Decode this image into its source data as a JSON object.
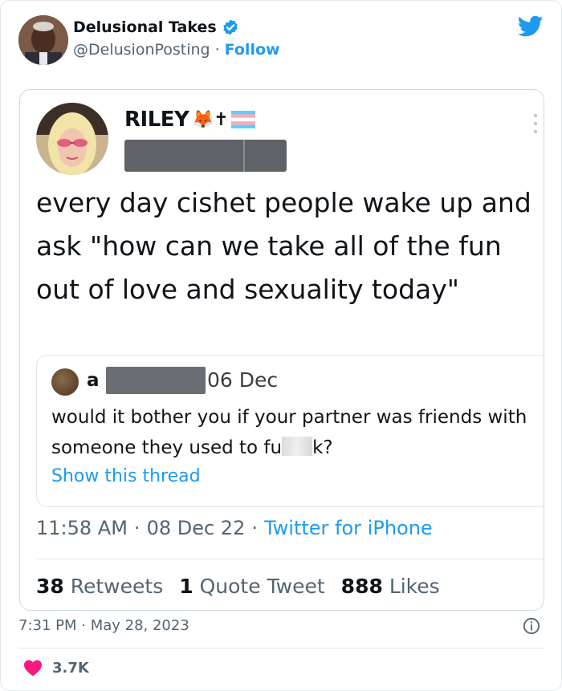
{
  "author": {
    "name": "Delusional Takes",
    "handle": "@DelusionPosting",
    "separator": "·",
    "follow_label": "Follow"
  },
  "screenshot": {
    "display_name": "RILEY",
    "name_emojis": "🦊✝",
    "tweet_text": "every day cishet people wake up and ask \"how can we take all of the fun out of love and sexuality today\"",
    "quote": {
      "name_initial": "a",
      "date": "06 Dec",
      "text_before": "would it bother you if your partner was friends with someone they used to fu",
      "text_after": "k?",
      "show_thread": "Show this thread"
    },
    "timestamp": {
      "time": "11:58 AM",
      "sep1": "·",
      "date": "08 Dec 22",
      "sep2": "·",
      "app": "Twitter for iPhone"
    },
    "stats": {
      "retweets_count": "38",
      "retweets_label": "Retweets",
      "quotes_count": "1",
      "quotes_label": "Quote Tweet",
      "likes_count": "888",
      "likes_label": "Likes"
    }
  },
  "footer": {
    "posted_at": "7:31 PM · May 28, 2023",
    "like_count": "3.7K"
  },
  "colors": {
    "accent": "#1d9bf0",
    "heart": "#f91880",
    "muted": "#536471"
  },
  "icons": [
    "verified-badge-icon",
    "twitter-logo-icon",
    "more-options-icon",
    "info-icon",
    "heart-icon",
    "trans-flag-icon"
  ]
}
